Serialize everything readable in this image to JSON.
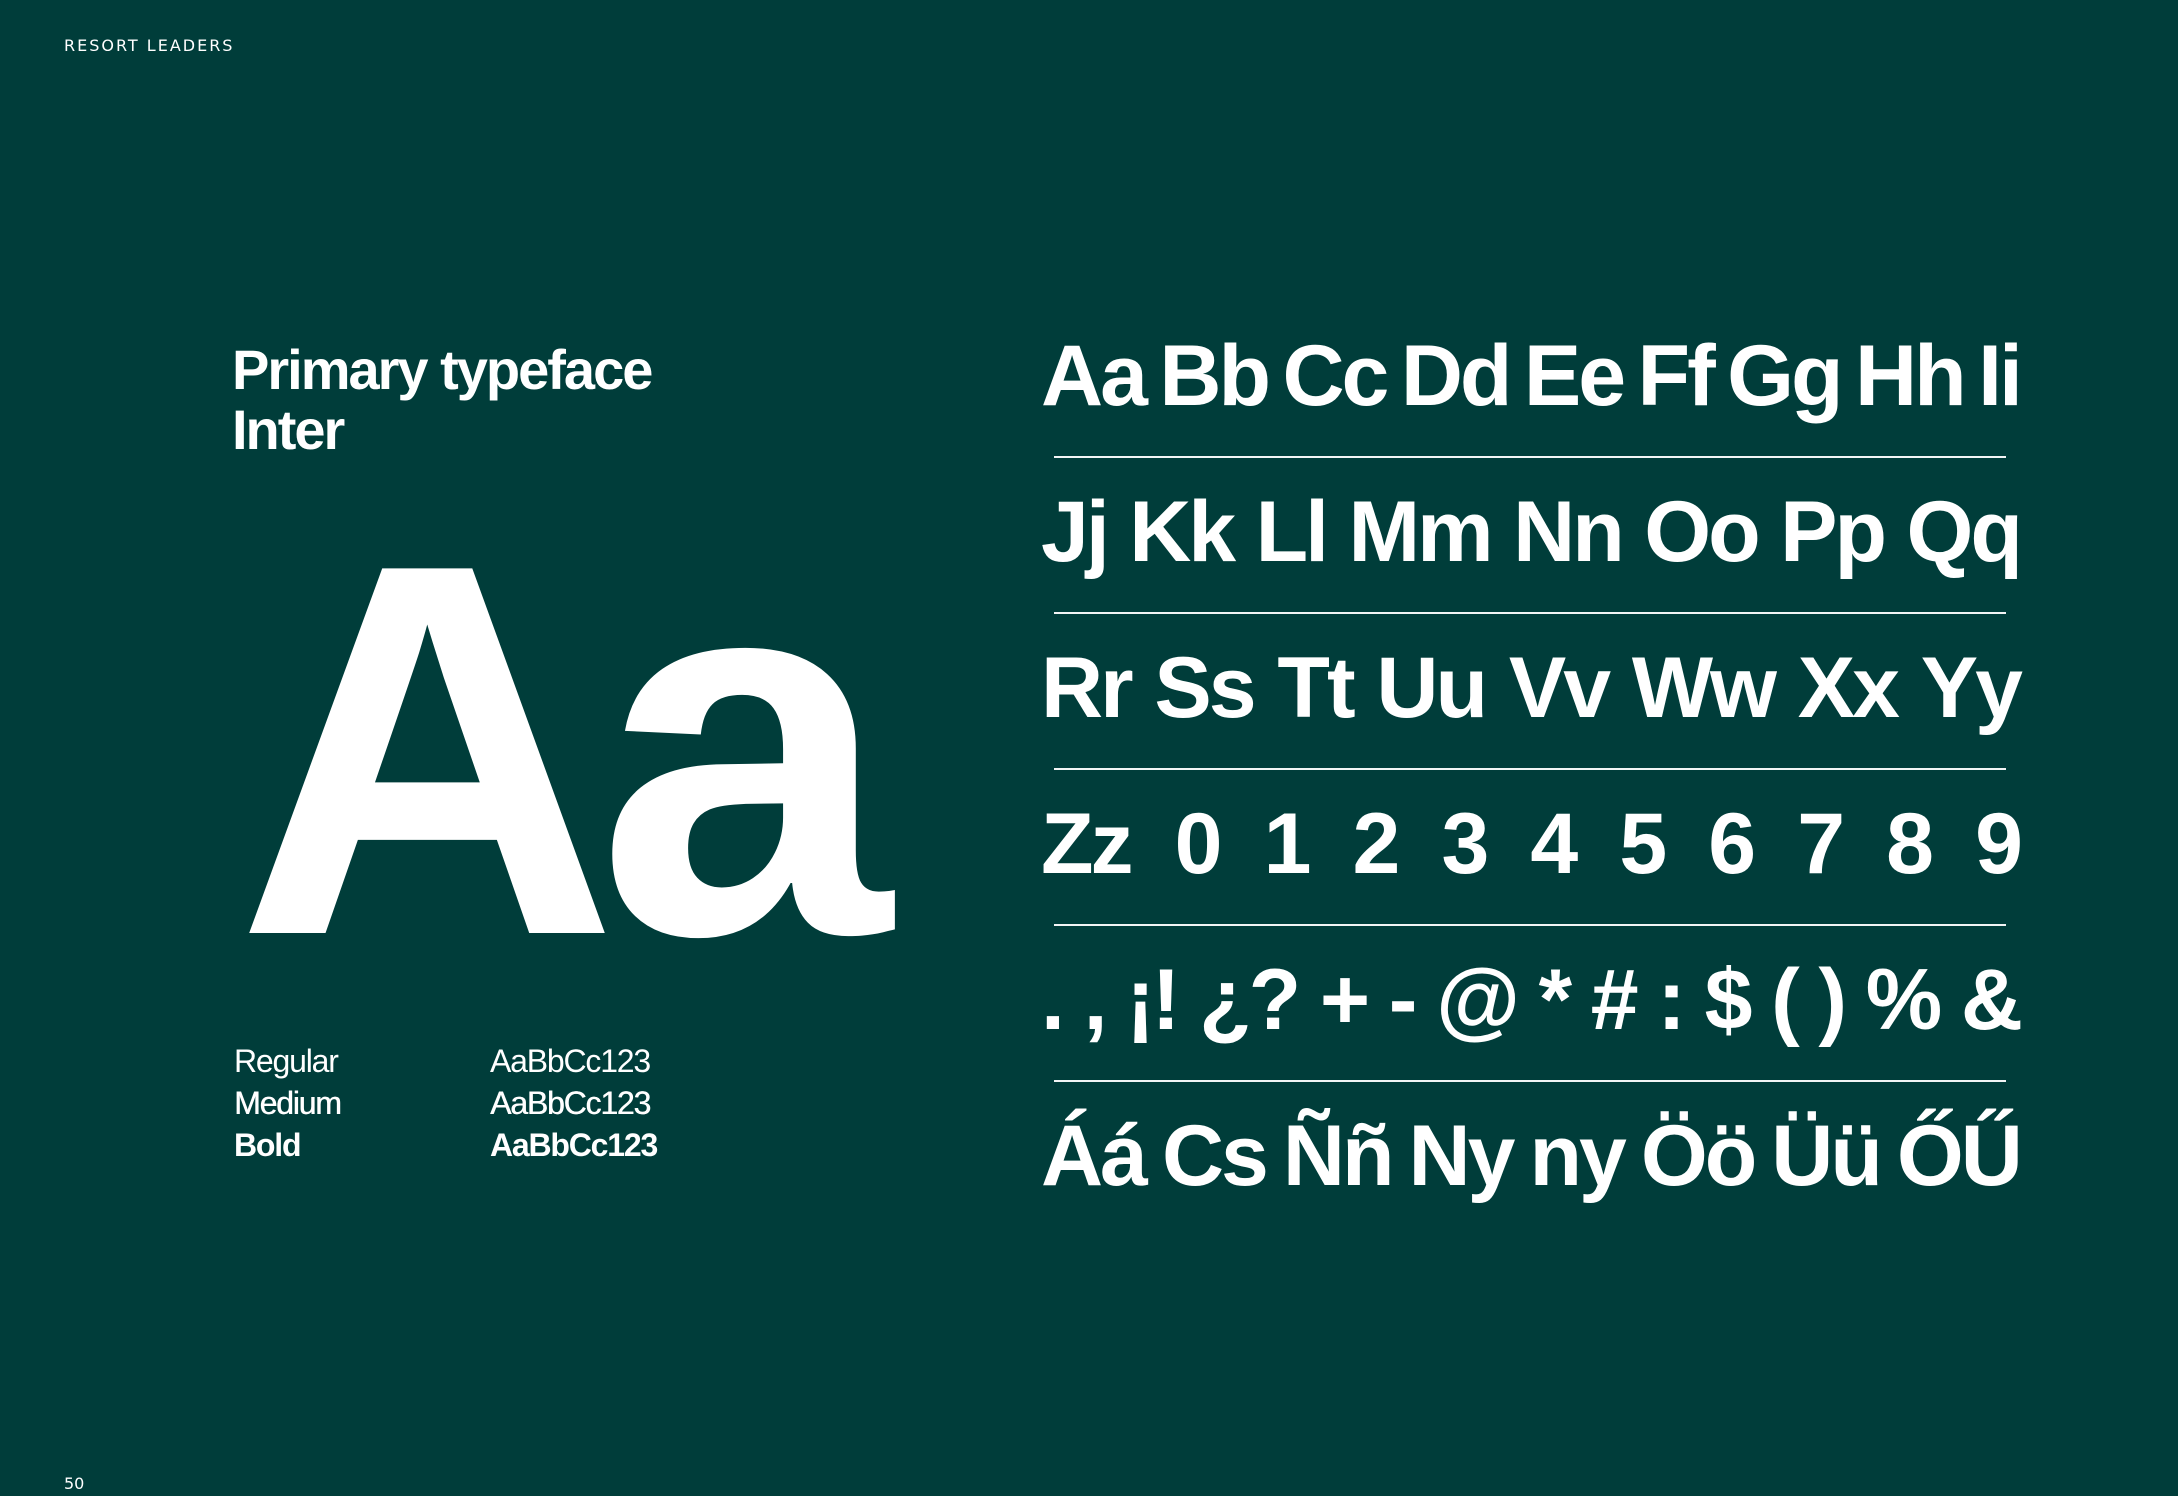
{
  "header": {
    "brand": "RESORT LEADERS"
  },
  "title": {
    "line1": "Primary typeface",
    "line2": "Inter"
  },
  "specimen": {
    "sample": "Aa"
  },
  "weights": [
    {
      "name": "Regular",
      "sample": "AaBbCc123"
    },
    {
      "name": "Medium",
      "sample": "AaBbCc123"
    },
    {
      "name": "Bold",
      "sample": "AaBbCc123"
    }
  ],
  "charset": {
    "rows": [
      [
        "Aa",
        "Bb",
        "Cc",
        "Dd",
        "Ee",
        "Ff",
        "Gg",
        "Hh",
        "Ii"
      ],
      [
        "Jj",
        "Kk",
        "Ll",
        "Mm",
        "Nn",
        "Oo",
        "Pp",
        "Qq"
      ],
      [
        "Rr",
        "Ss",
        "Tt",
        "Uu",
        "Vv",
        "Ww",
        "Xx",
        "Yy"
      ],
      [
        "Zz",
        "0",
        "1",
        "2",
        "3",
        "4",
        "5",
        "6",
        "7",
        "8",
        "9"
      ],
      [
        ".",
        ",",
        "¡!",
        "¿?",
        "+",
        "-",
        "@",
        "*",
        "#",
        ":",
        "$",
        "(",
        ")",
        "%",
        "&"
      ],
      [
        "Áá",
        "Cs",
        "Ññ",
        "Ny",
        "ny",
        "Öö",
        "Üü",
        "ŐŰ"
      ]
    ]
  },
  "footer": {
    "page_number": "50"
  }
}
